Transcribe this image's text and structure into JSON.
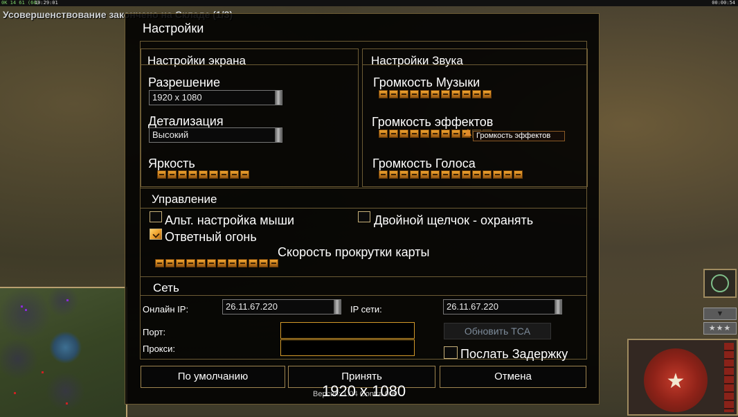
{
  "top_bar": {
    "fps": "0K 14 61 (60)",
    "clock": "10:29:01",
    "timer": "00:00:54"
  },
  "background_notice": "Усовершенствование закончено на Складе (1/3)",
  "dialog": {
    "title": "Настройки",
    "screen_settings": {
      "title": "Настройки экрана",
      "resolution_label": "Разрешение",
      "resolution_value": "1920 x 1080",
      "detail_label": "Детализация",
      "detail_value": "Высокий",
      "brightness_label": "Яркость",
      "brightness_level": 9,
      "brightness_max": 9
    },
    "sound_settings": {
      "title": "Настройки Звука",
      "music_label": "Громкость Музыки",
      "music_level": 11,
      "music_max": 11,
      "effects_label": "Громкость эффектов",
      "effects_level": 9,
      "effects_max": 11,
      "effects_tooltip": "Громкость эффектов",
      "voice_label": "Громкость Голоса",
      "voice_level": 14,
      "voice_max": 14
    },
    "controls": {
      "title": "Управление",
      "alt_mouse_label": "Альт. настройка мыши",
      "alt_mouse_checked": false,
      "double_click_label": "Двойной щелчок - охранять",
      "double_click_checked": false,
      "return_fire_label": "Ответный огонь",
      "return_fire_checked": true,
      "scroll_speed_label": "Скорость прокрутки карты",
      "scroll_speed_level": 12,
      "scroll_speed_max": 12
    },
    "network": {
      "title": "Сеть",
      "online_ip_label": "Онлайн IP:",
      "online_ip_value": "26.11.67.220",
      "lan_ip_label": "IP сети:",
      "lan_ip_value": "26.11.67.220",
      "port_label": "Порт:",
      "port_value": "",
      "proxy_label": "Прокси:",
      "proxy_value": "",
      "update_tca_label": "Обновить TCA",
      "send_delay_label": "Послать Задержку",
      "send_delay_checked": false
    },
    "buttons": {
      "defaults": "По умолчанию",
      "accept": "Принять",
      "cancel": "Отмена"
    },
    "version": "Версия: 1.04 Contra 009",
    "resolution_overlay": "1920 x 1080"
  },
  "colors": {
    "accent": "#f0a430",
    "border": "#6d5c35",
    "dialog_bg": "#000000"
  }
}
